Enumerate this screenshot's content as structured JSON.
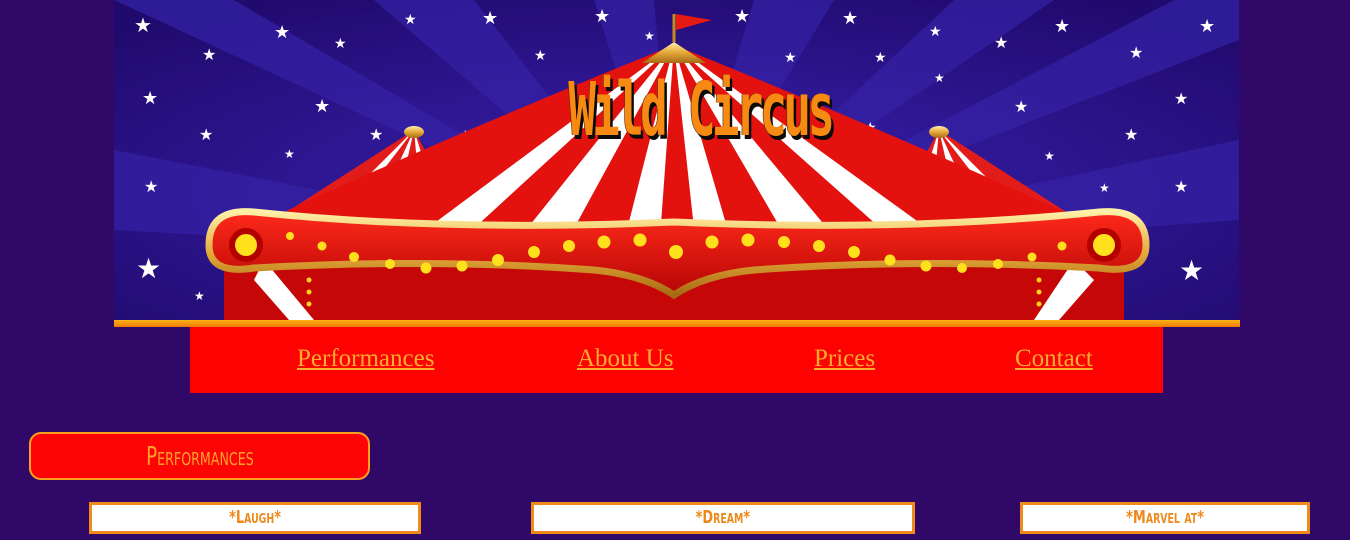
{
  "banner": {
    "title": "Wild Circus"
  },
  "nav": {
    "items": [
      {
        "label": "Performances"
      },
      {
        "label": "About Us"
      },
      {
        "label": "Prices"
      },
      {
        "label": "Contact"
      }
    ]
  },
  "section": {
    "heading": "Performances"
  },
  "cards": [
    {
      "label": "*Laugh*"
    },
    {
      "label": "*Dream*"
    },
    {
      "label": "*Marvel at*"
    }
  ],
  "colors": {
    "background": "#300968",
    "nav_bg": "#fe0202",
    "link": "#ffab2e",
    "accent": "#f78a12"
  }
}
